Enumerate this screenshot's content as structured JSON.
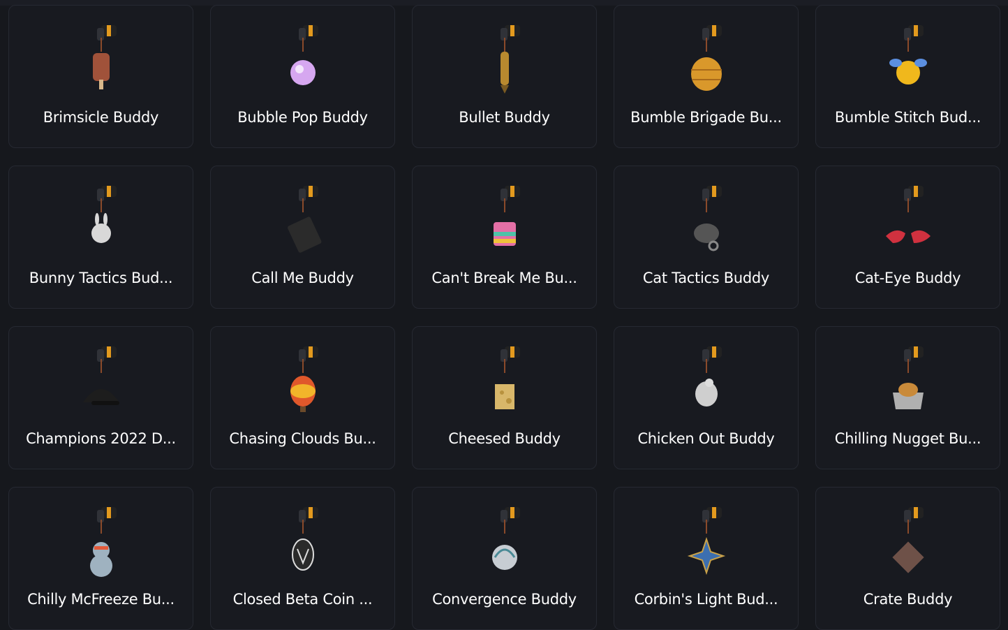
{
  "buddies": [
    {
      "name": "Brimsicle Buddy",
      "icon": "popsicle-charm-icon",
      "color": "#a0523a"
    },
    {
      "name": "Bubble Pop Buddy",
      "icon": "bubble-charm-icon",
      "color": "#d6a7f0"
    },
    {
      "name": "Bullet Buddy",
      "icon": "bullet-charm-icon",
      "color": "#b8892f"
    },
    {
      "name": "Bumble Brigade Bu...",
      "icon": "beehive-charm-icon",
      "color": "#d9982b"
    },
    {
      "name": "Bumble Stitch Bud...",
      "icon": "bee-charm-icon",
      "color": "#f0b81c"
    },
    {
      "name": "Bunny Tactics Bud...",
      "icon": "bunny-charm-icon",
      "color": "#d8d8d8"
    },
    {
      "name": "Call Me Buddy",
      "icon": "card-charm-icon",
      "color": "#2b2b2b"
    },
    {
      "name": "Can't Break Me Bu...",
      "icon": "pinata-charm-icon",
      "color": "#e46fa6"
    },
    {
      "name": "Cat Tactics Buddy",
      "icon": "cat-charm-icon",
      "color": "#555555"
    },
    {
      "name": "Cat-Eye Buddy",
      "icon": "glasses-charm-icon",
      "color": "#d0313f"
    },
    {
      "name": "Champions 2022 D...",
      "icon": "cap-charm-icon",
      "color": "#1d1d1d"
    },
    {
      "name": "Chasing Clouds Bu...",
      "icon": "balloon-charm-icon",
      "color": "#e0582b"
    },
    {
      "name": "Cheesed Buddy",
      "icon": "cheese-charm-icon",
      "color": "#d8b76a"
    },
    {
      "name": "Chicken Out Buddy",
      "icon": "chicken-charm-icon",
      "color": "#cfcfcf"
    },
    {
      "name": "Chilling Nugget Bu...",
      "icon": "nugget-charm-icon",
      "color": "#b0b0b0"
    },
    {
      "name": "Chilly McFreeze Bu...",
      "icon": "snowman-charm-icon",
      "color": "#9fb2c0"
    },
    {
      "name": "Closed Beta Coin ...",
      "icon": "coin-charm-icon",
      "color": "#2a2a2a"
    },
    {
      "name": "Convergence Buddy",
      "icon": "swirl-charm-icon",
      "color": "#c7cdd3"
    },
    {
      "name": "Corbin's Light Bud...",
      "icon": "star-charm-icon",
      "color": "#3c6fb0"
    },
    {
      "name": "Crate Buddy",
      "icon": "crate-charm-icon",
      "color": "#6e5148"
    }
  ]
}
